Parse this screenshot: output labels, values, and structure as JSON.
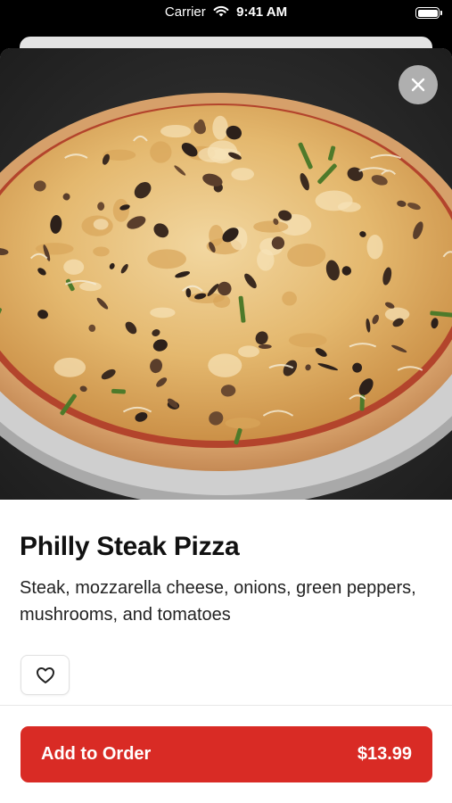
{
  "status_bar": {
    "carrier": "Carrier",
    "time": "9:41 AM",
    "battery_level": 1.0
  },
  "icons": {
    "close": "close-icon",
    "favorite": "heart-icon",
    "wifi": "wifi-icon",
    "battery": "battery-icon"
  },
  "item": {
    "image_alt": "Philly Steak Pizza",
    "title": "Philly Steak Pizza",
    "description": "Steak, mozzarella cheese, onions, green peppers, mushrooms, and tomatoes"
  },
  "footer": {
    "add_label": "Add to Order",
    "price": "$13.99"
  },
  "colors": {
    "accent": "#d92b25",
    "sheet_background": "#ffffff",
    "status_bar_background": "#000000"
  }
}
